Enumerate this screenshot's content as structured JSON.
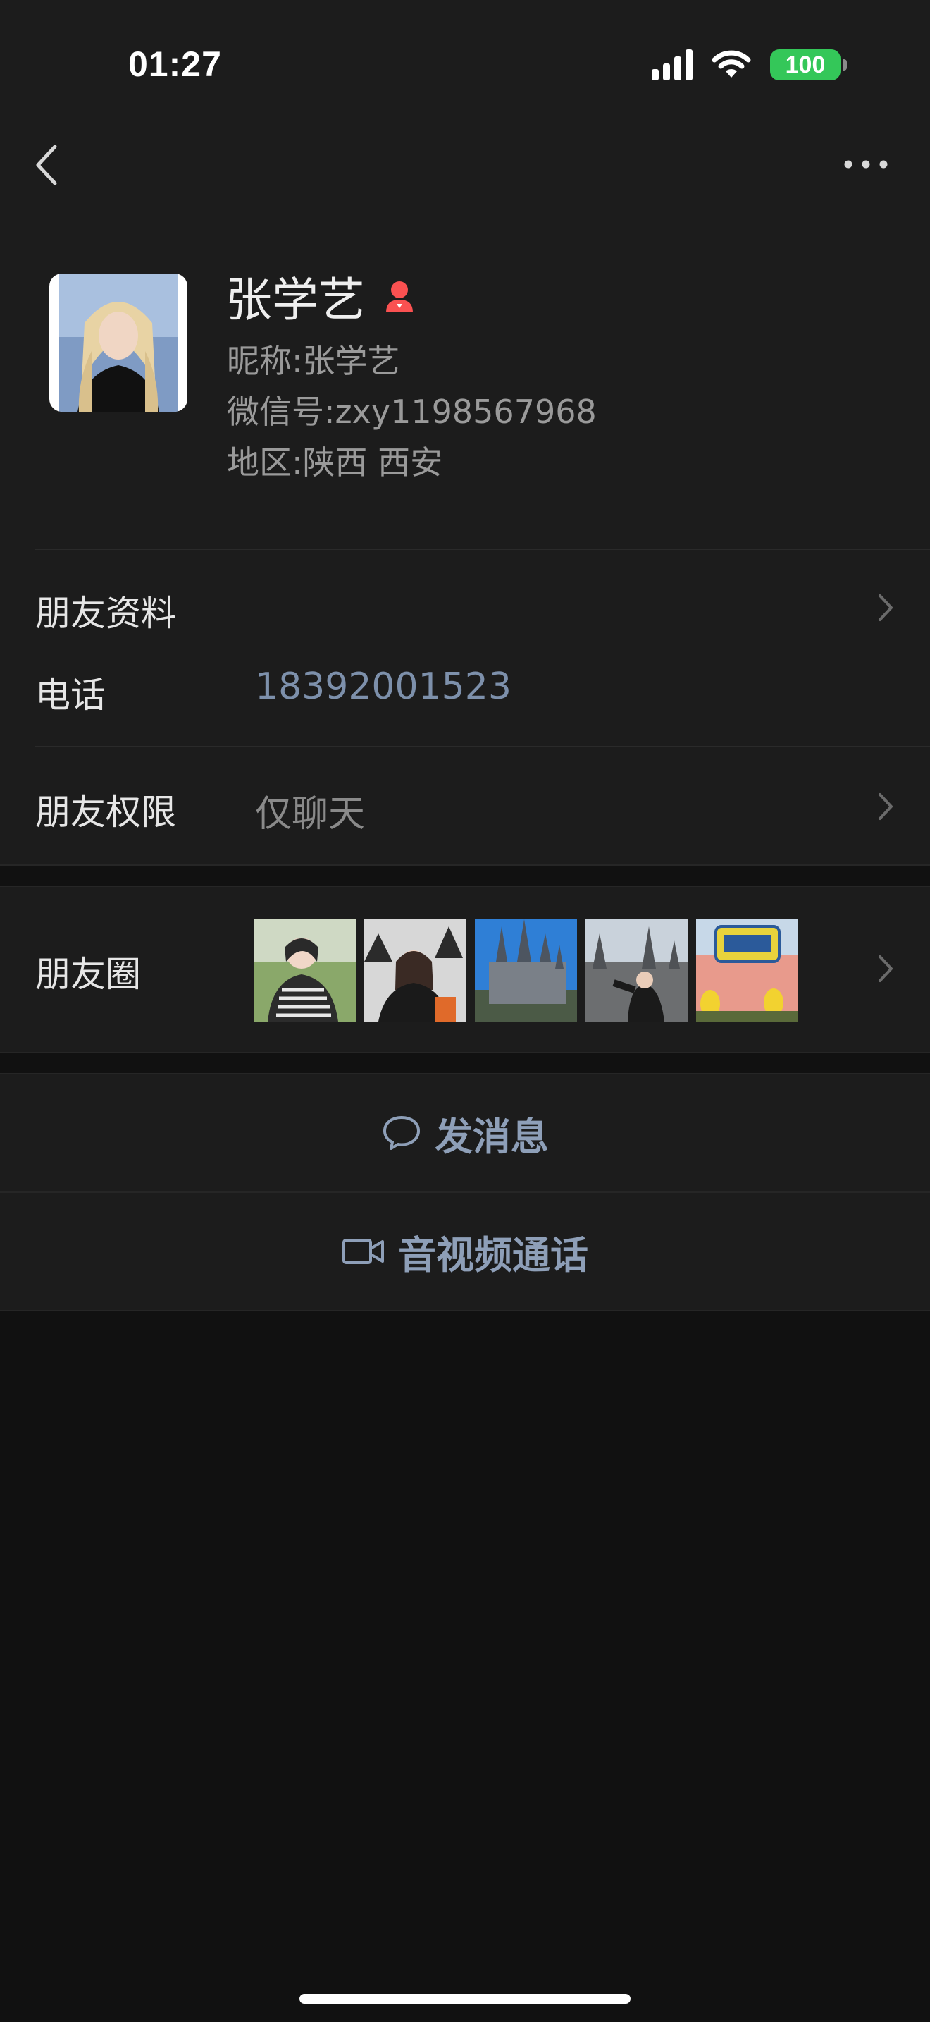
{
  "status_bar": {
    "time": "01:27",
    "battery": "100",
    "battery_color": "#34c759"
  },
  "profile": {
    "name": "张学艺",
    "nickname_label": "昵称:",
    "nickname": "张学艺",
    "wechat_id_label": "微信号:",
    "wechat_id": "zxy1198567968",
    "region_label": "地区:",
    "region": "陕西 西安",
    "gender_icon": "female-icon",
    "gender_color": "#fa5151"
  },
  "rows": {
    "friend_info": {
      "label": "朋友资料"
    },
    "phone": {
      "label": "电话",
      "value": "18392001523",
      "value_color": "#7d90ab"
    },
    "permissions": {
      "label": "朋友权限",
      "value": "仅聊天"
    },
    "moments": {
      "label": "朋友圈"
    }
  },
  "actions": {
    "message": {
      "label": "发消息",
      "icon": "chat-bubble-icon"
    },
    "call": {
      "label": "音视频通话",
      "icon": "video-camera-icon"
    }
  },
  "accent_link_color": "#8e9fb8"
}
